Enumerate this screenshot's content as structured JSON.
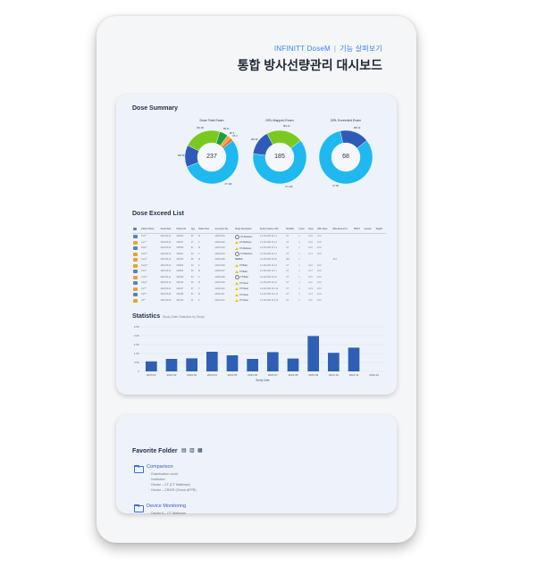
{
  "header": {
    "brand": "INFINITT DoseM",
    "separator": "|",
    "subtitle": "기능 살펴보기",
    "title": "통합 방사선량관리 대시보드"
  },
  "dose_summary": {
    "title": "Dose Summary",
    "donuts": [
      {
        "title": "Dose Total Exam",
        "total": "237",
        "segments": [
          {
            "label": "CT",
            "value": 116,
            "color": "#1fb9f0"
          },
          {
            "label": "MR",
            "value": 28,
            "color": "#2f5bb8"
          },
          {
            "label": "MG",
            "value": 48,
            "color": "#7bc920"
          },
          {
            "label": "XR",
            "value": 11,
            "color": "#1f9e3a"
          },
          {
            "label": "RF",
            "value": 5,
            "color": "#f4a23c"
          },
          {
            "label": "US",
            "value": 4,
            "color": "#f06b2a"
          }
        ]
      },
      {
        "title": "DRL Mapped Exam",
        "total": "185",
        "segments": [
          {
            "label": "CT",
            "value": 116,
            "color": "#1fb9f0"
          },
          {
            "label": "MR",
            "value": 28,
            "color": "#2f5bb8"
          },
          {
            "label": "MG",
            "value": 41,
            "color": "#7bc920"
          }
        ]
      },
      {
        "title": "DRL Exceeded Exam",
        "total": "68",
        "segments": [
          {
            "label": "CT",
            "value": 56,
            "color": "#1fb9f0"
          },
          {
            "label": "MR",
            "value": 12,
            "color": "#2f5bb8"
          }
        ]
      }
    ]
  },
  "dose_exceed": {
    "title": "Dose Exceed List",
    "columns": [
      "",
      "Patient Name",
      "Study Date",
      "Patient ID",
      "Age",
      "Patient Sex",
      "Accession No.",
      "Study Description",
      "Study Instance UID",
      "Modality",
      "Count",
      "Dose",
      "DRL Value",
      "DRL Exceed %",
      "MDCT",
      "Gender",
      "Weight"
    ],
    "rows": [
      {
        "icon": "b",
        "name": "Kim**",
        "date": "2024-05-14",
        "pid": "000342",
        "age": "53",
        "sex": "M",
        "acc": "A2024-001",
        "status": "ok",
        "status_text": "CT Abdomen",
        "uid": "1.2.410.200.10.1.1",
        "mod": "CT",
        "count": "1",
        "dose": "12.8",
        "drl": "10.0",
        "pct": ""
      },
      {
        "icon": "a",
        "name": "Lee**",
        "date": "2024-05-14",
        "pid": "000417",
        "age": "47",
        "sex": "F",
        "acc": "A2024-002",
        "status": "warn",
        "status_text": "CT Abdomen",
        "uid": "1.2.410.200.10.1.2",
        "mod": "CT",
        "count": "1",
        "dose": "13.4",
        "drl": "10.0",
        "pct": ""
      },
      {
        "icon": "b",
        "name": "Park**",
        "date": "2024-05-13",
        "pid": "000528",
        "age": "61",
        "sex": "M",
        "acc": "A2024-003",
        "status": "warn",
        "status_text": "CT Abdomen",
        "uid": "1.2.410.200.10.1.3",
        "mod": "CT",
        "count": "1",
        "dose": "11.9",
        "drl": "10.0",
        "pct": ""
      },
      {
        "icon": "a",
        "name": "Choi**",
        "date": "2024-05-13",
        "pid": "000611",
        "age": "39",
        "sex": "F",
        "acc": "A2024-004",
        "status": "ok",
        "status_text": "CT Abdomen",
        "uid": "1.2.410.200.10.1.4",
        "mod": "CT",
        "count": "1",
        "dose": "12.1",
        "drl": "10.0",
        "pct": ""
      },
      {
        "icon": "a",
        "name": "Jung**",
        "date": "2024-05-12",
        "pid": "000702",
        "age": "58",
        "sex": "M",
        "acc": "A2024-005",
        "status": "none",
        "status_text": "SERIES",
        "uid": "1.2.410.200.10.1.5",
        "mod": "MR",
        "count": "1",
        "dose": "",
        "drl": "",
        "pct": "23.6"
      },
      {
        "icon": "a",
        "name": "Kang**",
        "date": "2024-05-12",
        "pid": "000813",
        "age": "44",
        "sex": "F",
        "acc": "A2024-006",
        "status": "warn",
        "status_text": "CT Brain",
        "uid": "1.2.410.200.10.1.6",
        "mod": "CT",
        "count": "1",
        "dose": "14.2",
        "drl": "10.0",
        "pct": ""
      },
      {
        "icon": "b",
        "name": "Cho**",
        "date": "2024-05-11",
        "pid": "000924",
        "age": "66",
        "sex": "M",
        "acc": "A2024-007",
        "status": "warn",
        "status_text": "CT Brain",
        "uid": "1.2.410.200.10.1.7",
        "mod": "CT",
        "count": "1",
        "dose": "13.7",
        "drl": "10.0",
        "pct": ""
      },
      {
        "icon": "a",
        "name": "Yoon**",
        "date": "2024-05-11",
        "pid": "001035",
        "age": "52",
        "sex": "F",
        "acc": "A2024-008",
        "status": "ok",
        "status_text": "CT Brain",
        "uid": "1.2.410.200.10.1.8",
        "mod": "CT",
        "count": "1",
        "dose": "12.5",
        "drl": "10.0",
        "pct": ""
      },
      {
        "icon": "b",
        "name": "Jang**",
        "date": "2024-05-10",
        "pid": "001146",
        "age": "49",
        "sex": "M",
        "acc": "A2024-009",
        "status": "warn",
        "status_text": "CT Chest",
        "uid": "1.2.410.200.10.1.9",
        "mod": "CT",
        "count": "1",
        "dose": "11.2",
        "drl": "10.0",
        "pct": ""
      },
      {
        "icon": "a",
        "name": "Lim**",
        "date": "2024-05-10",
        "pid": "001257",
        "age": "57",
        "sex": "F",
        "acc": "A2024-010",
        "status": "warn",
        "status_text": "CT Chest",
        "uid": "1.2.410.200.10.1.10",
        "mod": "CT",
        "count": "1",
        "dose": "12.9",
        "drl": "10.0",
        "pct": ""
      },
      {
        "icon": "b",
        "name": "Han**",
        "date": "2024-05-09",
        "pid": "001368",
        "age": "63",
        "sex": "M",
        "acc": "A2024-011",
        "status": "warn",
        "status_text": "CT Chest",
        "uid": "1.2.410.200.10.1.11",
        "mod": "CT",
        "count": "1",
        "dose": "13.1",
        "drl": "10.0",
        "pct": ""
      },
      {
        "icon": "a",
        "name": "Oh**",
        "date": "2024-05-09",
        "pid": "001479",
        "age": "41",
        "sex": "F",
        "acc": "A2024-012",
        "status": "warn",
        "status_text": "CT Chest",
        "uid": "1.2.410.200.10.1.12",
        "mod": "CT",
        "count": "1",
        "dose": "11.6",
        "drl": "10.0",
        "pct": ""
      }
    ]
  },
  "statistics": {
    "title": "Statistics",
    "subtitle": "Study Date Statistics by Study"
  },
  "chart_data": {
    "type": "bar",
    "title": "",
    "xlabel": "Study Date",
    "ylabel": "",
    "categories": [
      "2023.01",
      "2023.02",
      "2023.03",
      "2023.04",
      "2023.05",
      "2023.06",
      "2023.07",
      "2023.08",
      "2023.09",
      "2023.10",
      "2023.11",
      "2023.12"
    ],
    "values": [
      0.56,
      0.7,
      0.73,
      1.1,
      0.9,
      0.7,
      1.08,
      0.72,
      1.98,
      1.04,
      1.33,
      0
    ],
    "yticks": [
      "0",
      "0.5K",
      "1.0K",
      "1.5K",
      "2.0K",
      "2.5K"
    ],
    "ylim": [
      0,
      2.5
    ],
    "bar_color": "#2f5fb5",
    "grid": true
  },
  "favorite_folder": {
    "title": "Favorite Folder",
    "icons": [
      "chart-icon",
      "chart-add-icon",
      "grid-icon"
    ],
    "folders": [
      {
        "label": "Comparison",
        "items": [
          "Examination count",
          "Institution",
          "Device – CT (CT Walkman)",
          "Device – CR/DR (Check AFPR)"
        ]
      },
      {
        "label": "Device Monitoring",
        "items": [
          "Device A – CT Walkman"
        ]
      }
    ]
  }
}
